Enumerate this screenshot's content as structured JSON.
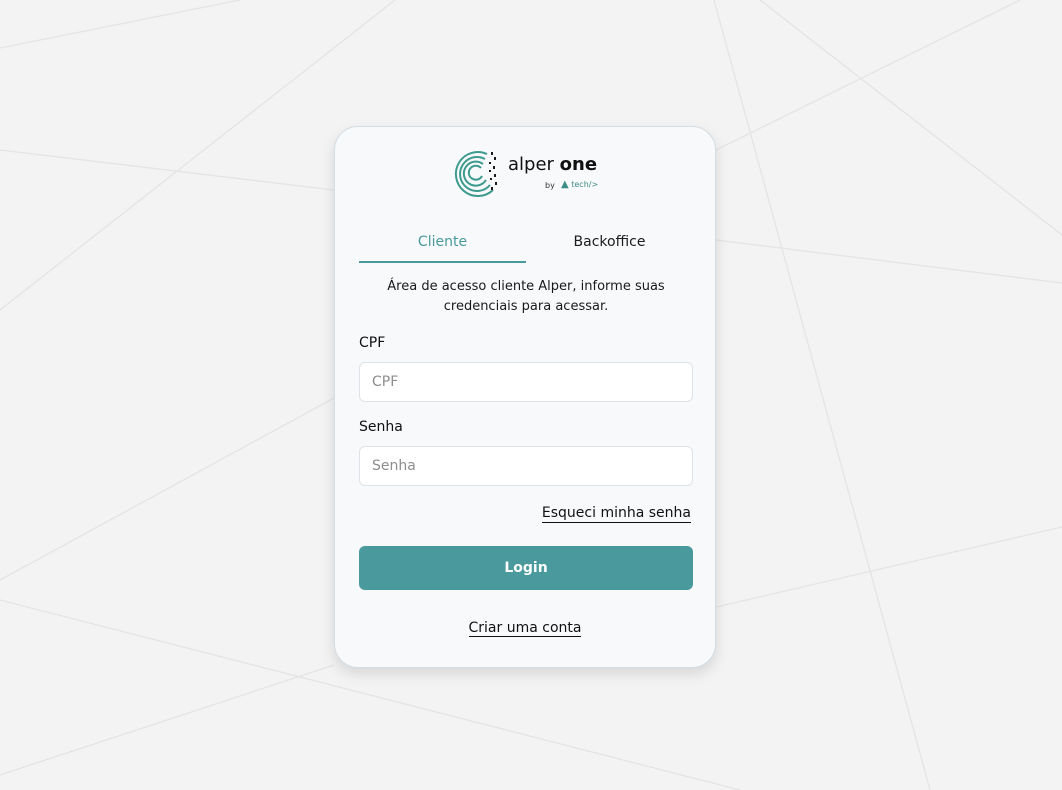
{
  "logo": {
    "brand_light": "alper ",
    "brand_bold": "one",
    "by": "by",
    "tech": "tech/>",
    "accent_color": "#3d8d88"
  },
  "tabs": [
    {
      "label": "Cliente",
      "active": true
    },
    {
      "label": "Backoffice",
      "active": false
    }
  ],
  "description": "Área de acesso cliente Alper, informe suas credenciais para acessar.",
  "form": {
    "cpf_label": "CPF",
    "cpf_placeholder": "CPF",
    "cpf_value": "",
    "senha_label": "Senha",
    "senha_placeholder": "Senha",
    "senha_value": ""
  },
  "forgot_password": "Esqueci minha senha",
  "login_button": "Login",
  "create_account": "Criar uma conta",
  "colors": {
    "primary": "#4a9a9d",
    "background": "#f3f3f3",
    "card": "#f7f9fb"
  }
}
